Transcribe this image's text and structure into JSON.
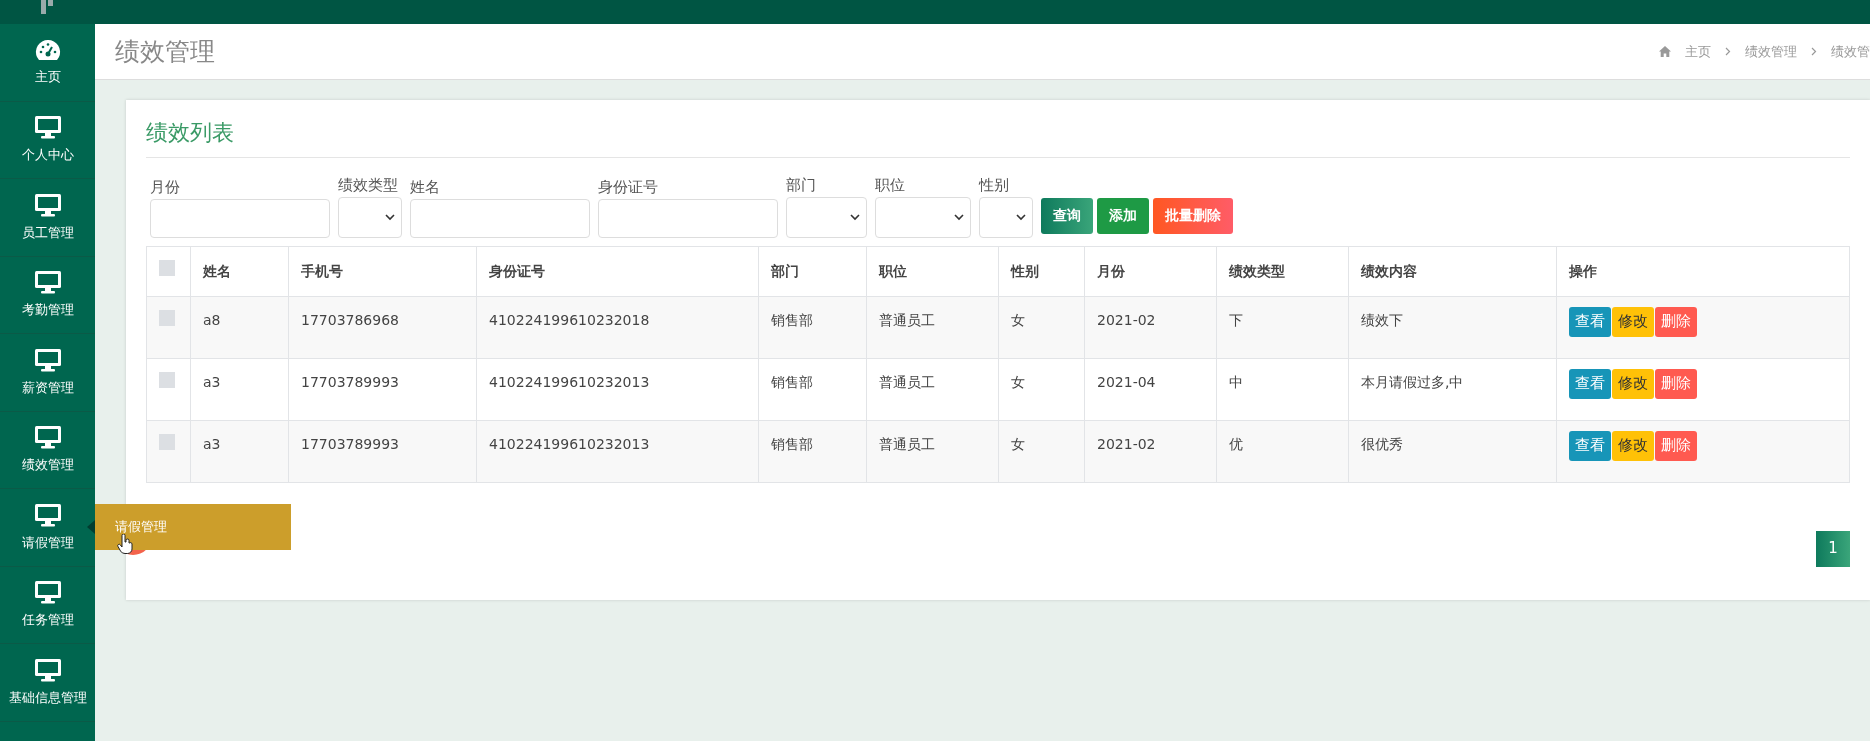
{
  "sidebar": {
    "items": [
      {
        "label": "主页"
      },
      {
        "label": "个人中心"
      },
      {
        "label": "员工管理"
      },
      {
        "label": "考勤管理"
      },
      {
        "label": "薪资管理"
      },
      {
        "label": "绩效管理"
      },
      {
        "label": "请假管理"
      },
      {
        "label": "任务管理"
      },
      {
        "label": "基础信息管理"
      }
    ],
    "tooltip": "请假管理"
  },
  "page_title": "绩效管理",
  "breadcrumb": [
    "主页",
    "绩效管理",
    "绩效管"
  ],
  "card": {
    "title": "绩效列表",
    "filters": [
      {
        "label": "月份",
        "kind": "input"
      },
      {
        "label": "绩效类型",
        "kind": "select"
      },
      {
        "label": "姓名",
        "kind": "input"
      },
      {
        "label": "身份证号",
        "kind": "input"
      },
      {
        "label": "部门",
        "kind": "select"
      },
      {
        "label": "职位",
        "kind": "select"
      },
      {
        "label": "性别",
        "kind": "select"
      }
    ],
    "buttons": [
      {
        "label": "查询",
        "kind": "search"
      },
      {
        "label": "添加",
        "kind": "add"
      },
      {
        "label": "批量删除",
        "kind": "delete"
      }
    ],
    "table": {
      "select_all_checked": false,
      "columns": [
        "姓名",
        "手机号",
        "身份证号",
        "部门",
        "职位",
        "性别",
        "月份",
        "绩效类型",
        "绩效内容",
        "操作"
      ],
      "rows": [
        {
          "checked": false,
          "cells": [
            "a8",
            "17703786968",
            "410224199610232018",
            "销售部",
            "普通员工",
            "女",
            "2021-02",
            "下",
            "绩效下"
          ],
          "actions": [
            {
              "label": "查看",
              "kind": "view"
            },
            {
              "label": "修改",
              "kind": "edit"
            },
            {
              "label": "删除",
              "kind": "delete"
            }
          ]
        },
        {
          "checked": false,
          "cells": [
            "a3",
            "17703789993",
            "410224199610232013",
            "销售部",
            "普通员工",
            "女",
            "2021-04",
            "中",
            "本月请假过多,中"
          ],
          "actions": [
            {
              "label": "查看",
              "kind": "view"
            },
            {
              "label": "修改",
              "kind": "edit"
            },
            {
              "label": "删除",
              "kind": "delete"
            }
          ]
        },
        {
          "checked": false,
          "cells": [
            "a3",
            "17703789993",
            "410224199610232013",
            "销售部",
            "普通员工",
            "女",
            "2021-02",
            "优",
            "很优秀"
          ],
          "actions": [
            {
              "label": "查看",
              "kind": "view"
            },
            {
              "label": "修改",
              "kind": "edit"
            },
            {
              "label": "删除",
              "kind": "delete"
            }
          ]
        }
      ]
    },
    "pagination": [
      {
        "label": "1",
        "selected": true
      }
    ]
  }
}
